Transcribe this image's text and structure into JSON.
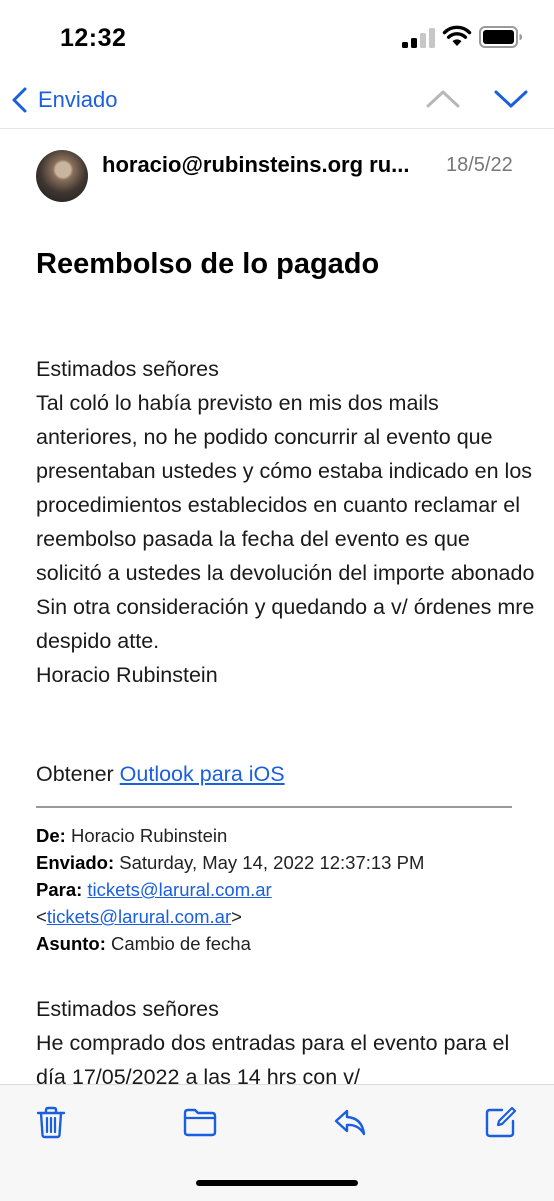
{
  "status_bar": {
    "time": "12:32"
  },
  "nav": {
    "back_label": "Enviado"
  },
  "header": {
    "sender": "horacio@rubinsteins.org ru...",
    "date": "18/5/22",
    "subject": "Reembolso de lo pagado"
  },
  "body": {
    "lines": [
      "Estimados señores",
      "Tal coló lo había previsto en mis dos mails anteriores, no he podido concurrir al evento que presentaban ustedes y cómo estaba indicado en los procedimientos establecidos en cuanto reclamar el reembolso pasada la fecha del evento es que solicitó a ustedes la devolución del importe abonado",
      "Sin otra consideración y quedando a v/ órdenes mre despido atte.",
      "Horacio Rubinstein"
    ],
    "obtain_prefix": "Obtener ",
    "obtain_link": "Outlook para iOS"
  },
  "forwarded": {
    "from_label": "De:",
    "from_value": "Horacio Rubinstein",
    "sent_label": "Enviado:",
    "sent_value": "Saturday, May 14, 2022 12:37:13 PM",
    "to_label": "Para:",
    "to_value": "tickets@larural.com.ar",
    "to_bracket_open": "<",
    "to_value2": "tickets@larural.com.ar",
    "to_bracket_close": ">",
    "subject_label": "Asunto:",
    "subject_value": "Cambio de fecha",
    "body_line1": "Estimados señores",
    "body_line2": "He comprado dos entradas para el evento para el día 17/05/2022  a las 14 hrs con v/"
  },
  "toolbar": {
    "icons": [
      "trash-icon",
      "folder-icon",
      "reply-icon",
      "compose-icon"
    ]
  },
  "colors": {
    "accent": "#1a5fe0",
    "text": "#000000",
    "secondary": "#777777"
  }
}
